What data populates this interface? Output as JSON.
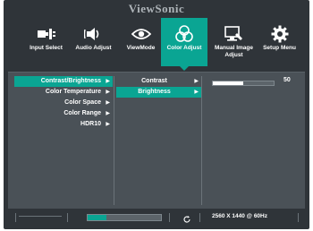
{
  "brand": "ViewSonic",
  "tabs": [
    {
      "label": "Input Select",
      "icon": "input-select-icon"
    },
    {
      "label": "Audio Adjust",
      "icon": "audio-speaker-icon"
    },
    {
      "label": "ViewMode",
      "icon": "eye-icon"
    },
    {
      "label": "Color Adjust",
      "icon": "color-circles-icon",
      "active": true
    },
    {
      "label": "Manual Image Adjust",
      "icon": "image-adjust-icon"
    },
    {
      "label": "Setup Menu",
      "icon": "gear-icon"
    }
  ],
  "menu_level1": [
    {
      "label": "Contrast/Brightness",
      "selected": true
    },
    {
      "label": "Color Temperature"
    },
    {
      "label": "Color Space"
    },
    {
      "label": "Color Range"
    },
    {
      "label": "HDR10"
    }
  ],
  "menu_level2": [
    {
      "label": "Contrast"
    },
    {
      "label": "Brightness",
      "selected": true
    }
  ],
  "brightness": {
    "value": "50",
    "fraction": 0.5
  },
  "status": {
    "resolution": "2560 X 1440 @ 60Hz",
    "progress_fraction": 0.26
  },
  "colors": {
    "accent": "#0aa593",
    "bezel": "#2f3439",
    "panel": "#4a5157"
  }
}
